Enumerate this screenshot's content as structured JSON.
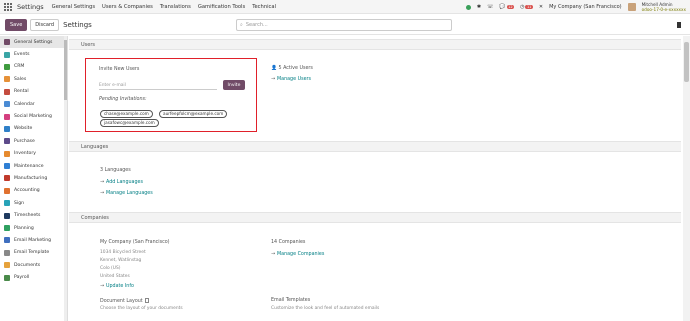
{
  "app": {
    "brand": "Settings",
    "nav": [
      "General Settings",
      "Users & Companies",
      "Translations",
      "Gamification Tools",
      "Technical"
    ],
    "notifications": {
      "chat_count": "12",
      "activity_count": "11"
    },
    "company": "My Company (San Francisco)",
    "user_name": "Mitchell Admin",
    "user_db": "odoo-17-0-e-xxxxxxx"
  },
  "control": {
    "save_label": "Save",
    "discard_label": "Discard",
    "title": "Settings",
    "search_placeholder": "Search..."
  },
  "sidebar": {
    "items": [
      {
        "label": "General Settings",
        "icon": "gear-icon",
        "color": "#714b67"
      },
      {
        "label": "Events",
        "icon": "events-icon",
        "color": "#3aa5a5"
      },
      {
        "label": "CRM",
        "icon": "crm-icon",
        "color": "#3f9b3f"
      },
      {
        "label": "Sales",
        "icon": "sales-icon",
        "color": "#e69138"
      },
      {
        "label": "Rental",
        "icon": "rental-icon",
        "color": "#c44c3f"
      },
      {
        "label": "Calendar",
        "icon": "calendar-icon",
        "color": "#4a8bd4"
      },
      {
        "label": "Social Marketing",
        "icon": "social-icon",
        "color": "#d43f7f"
      },
      {
        "label": "Website",
        "icon": "website-icon",
        "color": "#2f80c8"
      },
      {
        "label": "Purchase",
        "icon": "purchase-icon",
        "color": "#5d4a8a"
      },
      {
        "label": "Inventory",
        "icon": "inventory-icon",
        "color": "#e68a2e"
      },
      {
        "label": "Maintenance",
        "icon": "maintenance-icon",
        "color": "#2f7fd4"
      },
      {
        "label": "Manufacturing",
        "icon": "manufacturing-icon",
        "color": "#c0392b"
      },
      {
        "label": "Accounting",
        "icon": "accounting-icon",
        "color": "#e0712f"
      },
      {
        "label": "Sign",
        "icon": "sign-icon",
        "color": "#27a3b8"
      },
      {
        "label": "Timesheets",
        "icon": "timesheets-icon",
        "color": "#1f3a5f"
      },
      {
        "label": "Planning",
        "icon": "planning-icon",
        "color": "#2fa060"
      },
      {
        "label": "Email Marketing",
        "icon": "email-marketing-icon",
        "color": "#3f6fbf"
      },
      {
        "label": "Email Template",
        "icon": "email-template-icon",
        "color": "#888888"
      },
      {
        "label": "Documents",
        "icon": "documents-icon",
        "color": "#e6a23c"
      },
      {
        "label": "Payroll",
        "icon": "payroll-icon",
        "color": "#4a8a4a"
      }
    ]
  },
  "users": {
    "section_title": "Users",
    "invite_title": "Invite New Users",
    "email_placeholder": "Enter e-mail",
    "invite_label": "Invite",
    "pending_title": "Pending Invitations:",
    "pending": [
      "chase@example.com",
      "aurfeepfolcm@example.com",
      "jasafowc@example.com"
    ],
    "active_users": "5 Active Users",
    "manage_users": "Manage Users"
  },
  "languages": {
    "section_title": "Languages",
    "count": "3 Languages",
    "add_languages": "Add Languages",
    "manage_languages": "Manage Languages"
  },
  "companies": {
    "section_title": "Companies",
    "company_name": "My Company (San Francisco)",
    "address": [
      "1034 Bicycled Street",
      "Kennet, Watlinstag",
      "Colo (US)",
      "United States"
    ],
    "update_info": "Update Info",
    "count": "14 Companies",
    "manage_companies": "Manage Companies",
    "doc_layout_title": "Document Layout",
    "doc_layout_desc": "Choose the layout of your documents",
    "email_templates_title": "Email Templates",
    "email_templates_desc": "Customize the look and feel of automated emails"
  }
}
